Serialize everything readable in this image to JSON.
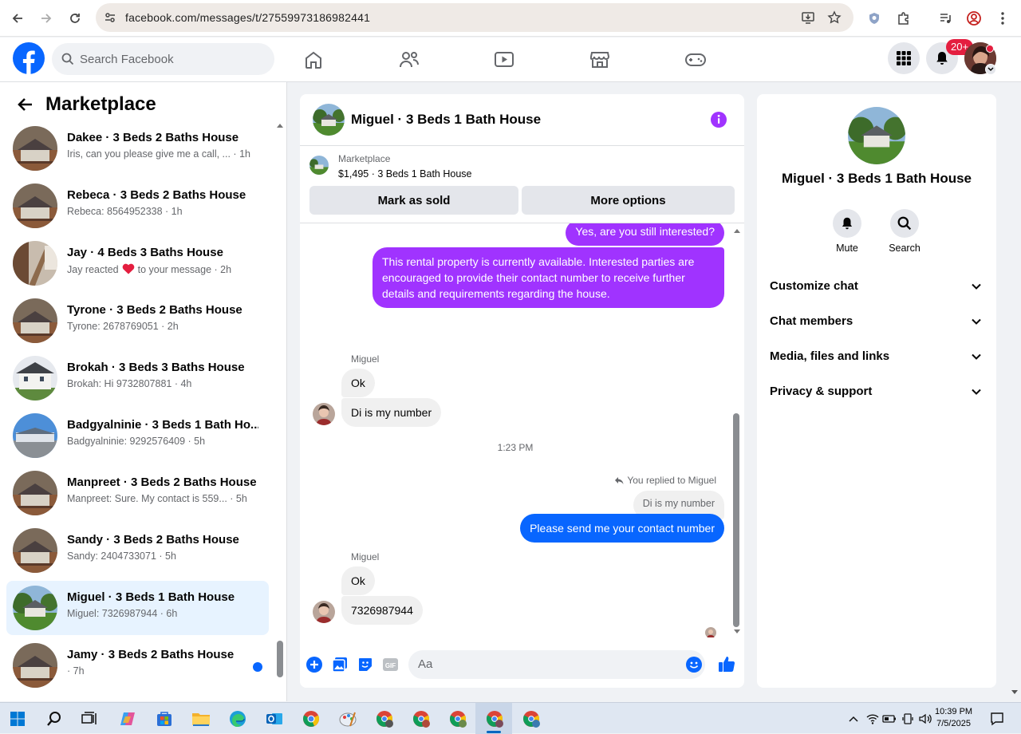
{
  "browser": {
    "url": "facebook.com/messages/t/27559973186982441"
  },
  "nav": {
    "search_placeholder": "Search Facebook",
    "notification_badge": "20+"
  },
  "left": {
    "title": "Marketplace",
    "conversations": [
      {
        "name": "Dakee · 3 Beds 2 Baths House",
        "preview": "Iris, can you please give me a call, ... · 1h",
        "selected": false,
        "unread": false
      },
      {
        "name": "Rebeca · 3 Beds 2 Baths House",
        "preview": "Rebeca: 8564952338 · 1h",
        "selected": false,
        "unread": false
      },
      {
        "name": "Jay · 4 Beds 3 Baths House",
        "preview_a": "Jay reacted",
        "preview_b": "to your message · 2h",
        "selected": false,
        "unread": false
      },
      {
        "name": "Tyrone · 3 Beds 2 Baths House",
        "preview": "Tyrone: 2678769051 · 2h",
        "selected": false,
        "unread": false
      },
      {
        "name": "Brokah · 3 Beds 3 Baths House",
        "preview": "Brokah: Hi 9732807881 · 4h",
        "selected": false,
        "unread": false
      },
      {
        "name": "Badgyalninie · 3 Beds 1 Bath Ho...",
        "preview": "Badgyalninie: 9292576409 · 5h",
        "selected": false,
        "unread": false
      },
      {
        "name": "Manpreet · 3 Beds 2 Baths House",
        "preview": "Manpreet: Sure. My contact is 559... · 5h",
        "selected": false,
        "unread": false
      },
      {
        "name": "Sandy · 3 Beds 2 Baths House",
        "preview": "Sandy: 2404733071 · 5h",
        "selected": false,
        "unread": false
      },
      {
        "name": "Miguel · 3 Beds 1 Bath House",
        "preview": "Miguel: 7326987944 · 6h",
        "selected": true,
        "unread": false
      },
      {
        "name": "Jamy · 3 Beds 2 Baths House",
        "preview": " · 7h",
        "selected": false,
        "unread": true
      }
    ]
  },
  "chat": {
    "title": "Miguel · 3 Beds 1 Bath House",
    "listing_label": "Marketplace",
    "listing_price": "$1,495 · 3 Beds 1 Bath House",
    "mark_sold": "Mark as sold",
    "more_options": "More options",
    "messages": {
      "m1": "Yes, are you still interested?",
      "m2": "This rental property is currently available. Interested parties are encouraged to provide their contact number to receive further details and requirements regarding the house.",
      "sender1": "Miguel",
      "m3": "Ok",
      "m4": "Di is my number",
      "time": "1:23 PM",
      "replied": "You replied to Miguel",
      "quoted": "Di is my number",
      "m5": "Please send me your contact number",
      "sender2": "Miguel",
      "m6": "Ok",
      "m7": "7326987944"
    },
    "composer_placeholder": "Aa"
  },
  "right": {
    "name": "Miguel · 3 Beds 1 Bath House",
    "mute": "Mute",
    "search": "Search",
    "sections": [
      "Customize chat",
      "Chat members",
      "Media, files and links",
      "Privacy & support"
    ]
  },
  "taskbar": {
    "time": "10:39 PM",
    "date": "7/5/2025"
  },
  "colors": {
    "fb_blue": "#0866ff",
    "purple_bubble": "#a033ff"
  }
}
